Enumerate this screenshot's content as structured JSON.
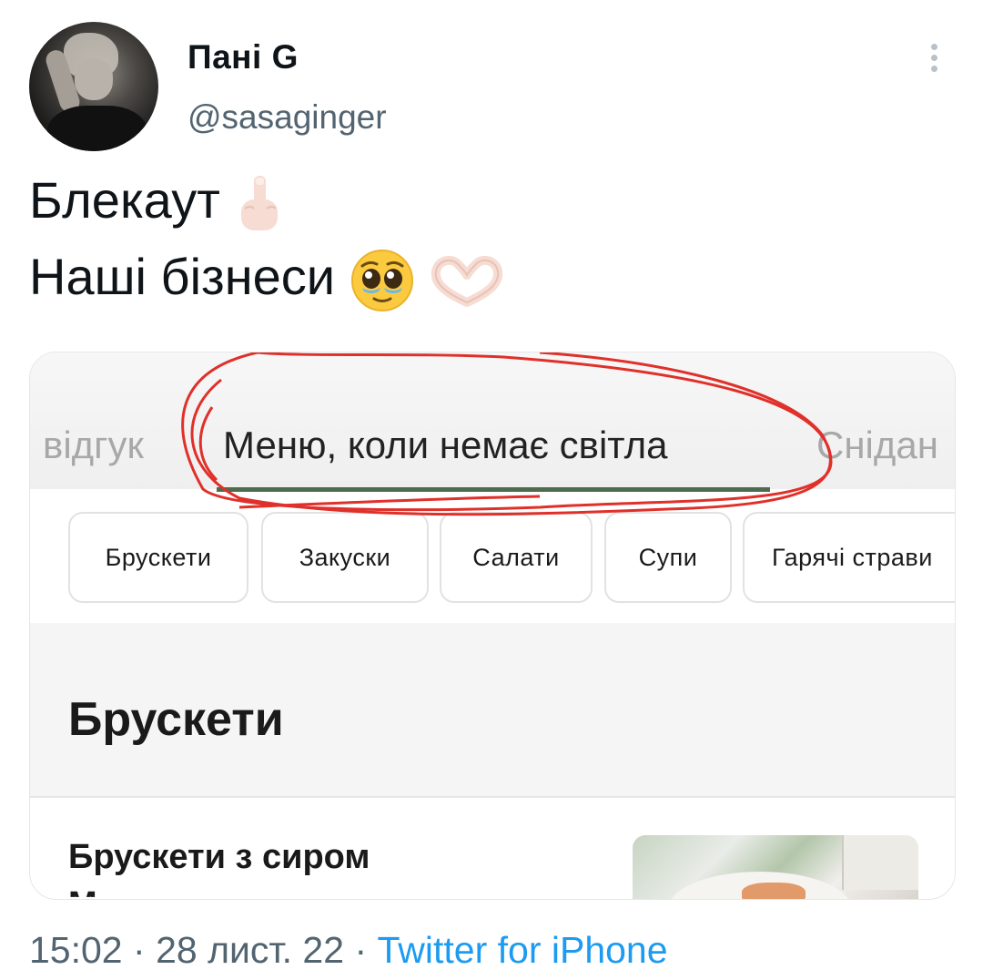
{
  "user": {
    "display_name": "Пані G",
    "handle": "@sasaginger"
  },
  "tweet": {
    "line1": "Блекаут",
    "line2": "Наші бізнеси",
    "emojis": [
      "middle-finger-light-skin",
      "pleading-face",
      "heart-hands-light-skin"
    ]
  },
  "media": {
    "tabs": [
      "відгук",
      "Меню, коли немає світла",
      "Снідан"
    ],
    "active_tab": "Меню, коли немає світла",
    "accent_color": "#4d6b4d",
    "annotation_color": "#e0302a",
    "categories": [
      "Брускети",
      "Закуски",
      "Салати",
      "Супи",
      "Гарячі страви"
    ],
    "section_title": "Брускети",
    "item_title_line1": "Брускети з сиром",
    "item_title_line2": "М..........."
  },
  "footer": {
    "time": "15:02",
    "sep1": "·",
    "date": "28 лист. 22",
    "sep2": "·",
    "source": "Twitter for iPhone"
  }
}
